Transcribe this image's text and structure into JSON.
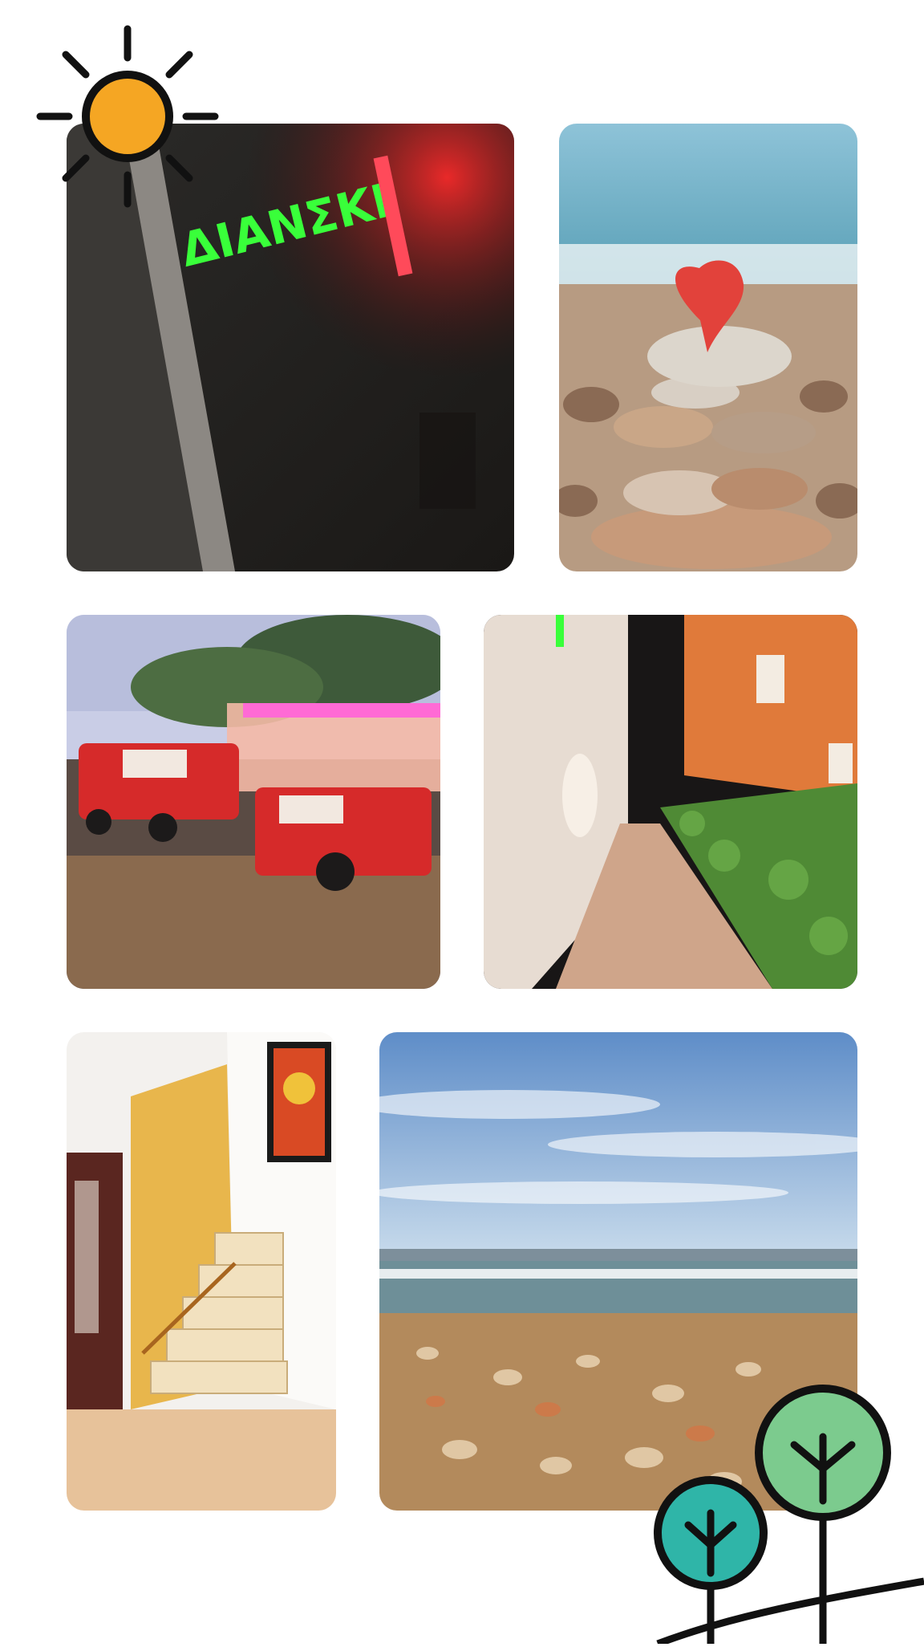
{
  "collage": {
    "background": "#ffffff",
    "decorations": [
      {
        "name": "sun-icon",
        "color": "#F5A623",
        "stroke": "#111111"
      },
      {
        "name": "tree-icon",
        "color": "#7CCB8E",
        "stroke": "#111111"
      },
      {
        "name": "tree-icon",
        "color": "#2FB5A8",
        "stroke": "#111111"
      }
    ],
    "photos": [
      {
        "name": "photo-neon-sign",
        "subject": "neon-sign",
        "neon_text": "ΔΙΑΝΣΚΙ",
        "accent": "#39FF3A"
      },
      {
        "name": "photo-heart-stone-cairn",
        "subject": "heart-stone-cairn",
        "accent": "#E2423B"
      },
      {
        "name": "photo-tourist-train",
        "subject": "tourist-train",
        "accent": "#D62A2A"
      },
      {
        "name": "photo-hotel-walkway",
        "subject": "hotel-walkway",
        "accent": "#E07A3A"
      },
      {
        "name": "photo-staircase",
        "subject": "staircase",
        "accent": "#E8B64C"
      },
      {
        "name": "photo-beach-shells",
        "subject": "beach-shells",
        "accent": "#5E8DC8"
      }
    ]
  }
}
